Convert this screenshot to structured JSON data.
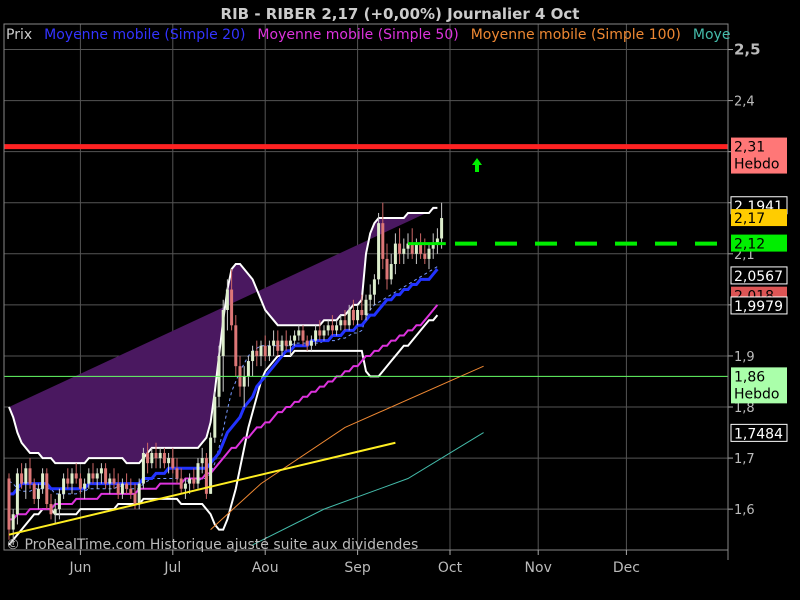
{
  "chart_data": {
    "type": "candlestick",
    "title": "RIB - RIBER     2,17 (+0,00%)     Journalier  4 Oct",
    "legend": [
      {
        "label": "Prix",
        "color": "#cccccc"
      },
      {
        "label": "Moyenne mobile (Simple 20)",
        "color": "#3333ff"
      },
      {
        "label": "Moyenne mobile (Simple 50)",
        "color": "#dd33dd"
      },
      {
        "label": "Moyenne mobile (Simple 100)",
        "color": "#ee8833"
      },
      {
        "label": "Moye",
        "color": "#44bbaa"
      }
    ],
    "x_tick_labels": [
      "Jun",
      "Jul",
      "Aou",
      "Sep",
      "Oct",
      "Nov",
      "Dec"
    ],
    "y_tick_labels": [
      "2,5",
      "2,4",
      "2,3",
      "2,2",
      "2,1",
      "2",
      "1,9",
      "1,8",
      "1,7",
      "1,6"
    ],
    "ylim": [
      1.52,
      2.55
    ],
    "grid": true,
    "watermark": "© ProRealTime.com Historique ajusté suite aux dividendes",
    "price_labels": [
      {
        "value": 2.31,
        "text": "2,31",
        "sub": "Hebdo",
        "bg": "#ff7777",
        "fg": "#000000"
      },
      {
        "value": 2.1941,
        "text": "2,1941",
        "bg": "#000000",
        "fg": "#ffffff",
        "border": "#ffffff"
      },
      {
        "value": 2.17,
        "text": "2,17",
        "bg": "#ffcc00",
        "fg": "#000000"
      },
      {
        "value": 2.12,
        "text": "2,12",
        "bg": "#00ee00",
        "fg": "#000000"
      },
      {
        "value": 2.056,
        "text": "2,056",
        "bg": "#cc33cc",
        "fg": "#000000"
      },
      {
        "value": 2.0567,
        "text": "2,0567",
        "bg": "#000000",
        "fg": "#ffffff",
        "border": "#ffffff"
      },
      {
        "value": 2.018,
        "text": "2,018",
        "bg": "#dd5555",
        "fg": "#000000"
      },
      {
        "value": 1.9979,
        "text": "1,9979",
        "bg": "#000000",
        "fg": "#ffffff",
        "border": "#ffffff"
      },
      {
        "value": 1.86,
        "text": "1,86",
        "sub": "Hebdo",
        "bg": "#aaffaa",
        "fg": "#000000"
      },
      {
        "value": 1.7484,
        "text": "1,7484",
        "bg": "#000000",
        "fg": "#ffffff",
        "border": "#ffffff"
      }
    ],
    "hlines": [
      {
        "value": 2.31,
        "color": "#ff2222"
      },
      {
        "value": 1.86,
        "color": "#66ff66"
      }
    ],
    "target_line": {
      "value": 2.12,
      "color": "#00ee00"
    },
    "trendline": [
      {
        "x": 0,
        "y": 1.55
      },
      {
        "x": 92,
        "y": 1.73
      }
    ],
    "up_arrow": {
      "x": 122,
      "y": 2.28,
      "color": "#00ee00"
    },
    "ma100_end": {
      "x": 113,
      "y": 1.88
    },
    "ma200_end": {
      "x": 113,
      "y": 1.75
    },
    "candles": [
      {
        "o": 1.66,
        "h": 1.67,
        "l": 1.54,
        "c": 1.56
      },
      {
        "o": 1.56,
        "h": 1.6,
        "l": 1.53,
        "c": 1.59
      },
      {
        "o": 1.59,
        "h": 1.68,
        "l": 1.57,
        "c": 1.67
      },
      {
        "o": 1.67,
        "h": 1.69,
        "l": 1.64,
        "c": 1.65
      },
      {
        "o": 1.65,
        "h": 1.69,
        "l": 1.62,
        "c": 1.68
      },
      {
        "o": 1.68,
        "h": 1.7,
        "l": 1.64,
        "c": 1.65
      },
      {
        "o": 1.65,
        "h": 1.66,
        "l": 1.61,
        "c": 1.62
      },
      {
        "o": 1.62,
        "h": 1.65,
        "l": 1.6,
        "c": 1.64
      },
      {
        "o": 1.64,
        "h": 1.68,
        "l": 1.63,
        "c": 1.67
      },
      {
        "o": 1.67,
        "h": 1.68,
        "l": 1.6,
        "c": 1.61
      },
      {
        "o": 1.61,
        "h": 1.63,
        "l": 1.58,
        "c": 1.59
      },
      {
        "o": 1.59,
        "h": 1.62,
        "l": 1.57,
        "c": 1.6
      },
      {
        "o": 1.6,
        "h": 1.64,
        "l": 1.58,
        "c": 1.63
      },
      {
        "o": 1.63,
        "h": 1.67,
        "l": 1.62,
        "c": 1.66
      },
      {
        "o": 1.66,
        "h": 1.68,
        "l": 1.64,
        "c": 1.65
      },
      {
        "o": 1.65,
        "h": 1.68,
        "l": 1.63,
        "c": 1.67
      },
      {
        "o": 1.67,
        "h": 1.69,
        "l": 1.65,
        "c": 1.66
      },
      {
        "o": 1.66,
        "h": 1.67,
        "l": 1.63,
        "c": 1.64
      },
      {
        "o": 1.64,
        "h": 1.66,
        "l": 1.62,
        "c": 1.65
      },
      {
        "o": 1.65,
        "h": 1.68,
        "l": 1.64,
        "c": 1.67
      },
      {
        "o": 1.67,
        "h": 1.69,
        "l": 1.65,
        "c": 1.66
      },
      {
        "o": 1.66,
        "h": 1.68,
        "l": 1.64,
        "c": 1.67
      },
      {
        "o": 1.67,
        "h": 1.69,
        "l": 1.65,
        "c": 1.68
      },
      {
        "o": 1.68,
        "h": 1.69,
        "l": 1.64,
        "c": 1.65
      },
      {
        "o": 1.65,
        "h": 1.67,
        "l": 1.63,
        "c": 1.66
      },
      {
        "o": 1.66,
        "h": 1.68,
        "l": 1.64,
        "c": 1.65
      },
      {
        "o": 1.65,
        "h": 1.67,
        "l": 1.62,
        "c": 1.63
      },
      {
        "o": 1.63,
        "h": 1.66,
        "l": 1.62,
        "c": 1.65
      },
      {
        "o": 1.65,
        "h": 1.67,
        "l": 1.63,
        "c": 1.64
      },
      {
        "o": 1.64,
        "h": 1.66,
        "l": 1.62,
        "c": 1.63
      },
      {
        "o": 1.63,
        "h": 1.65,
        "l": 1.6,
        "c": 1.61
      },
      {
        "o": 1.61,
        "h": 1.66,
        "l": 1.6,
        "c": 1.65
      },
      {
        "o": 1.65,
        "h": 1.72,
        "l": 1.64,
        "c": 1.71
      },
      {
        "o": 1.71,
        "h": 1.73,
        "l": 1.67,
        "c": 1.69
      },
      {
        "o": 1.69,
        "h": 1.72,
        "l": 1.68,
        "c": 1.71
      },
      {
        "o": 1.71,
        "h": 1.73,
        "l": 1.68,
        "c": 1.7
      },
      {
        "o": 1.7,
        "h": 1.72,
        "l": 1.68,
        "c": 1.71
      },
      {
        "o": 1.71,
        "h": 1.72,
        "l": 1.68,
        "c": 1.69
      },
      {
        "o": 1.69,
        "h": 1.71,
        "l": 1.67,
        "c": 1.7
      },
      {
        "o": 1.7,
        "h": 1.72,
        "l": 1.67,
        "c": 1.68
      },
      {
        "o": 1.68,
        "h": 1.7,
        "l": 1.65,
        "c": 1.66
      },
      {
        "o": 1.66,
        "h": 1.68,
        "l": 1.63,
        "c": 1.64
      },
      {
        "o": 1.64,
        "h": 1.66,
        "l": 1.62,
        "c": 1.65
      },
      {
        "o": 1.65,
        "h": 1.67,
        "l": 1.63,
        "c": 1.66
      },
      {
        "o": 1.66,
        "h": 1.68,
        "l": 1.64,
        "c": 1.65
      },
      {
        "o": 1.65,
        "h": 1.7,
        "l": 1.64,
        "c": 1.69
      },
      {
        "o": 1.69,
        "h": 1.72,
        "l": 1.67,
        "c": 1.7
      },
      {
        "o": 1.7,
        "h": 1.71,
        "l": 1.62,
        "c": 1.63
      },
      {
        "o": 1.63,
        "h": 1.75,
        "l": 1.63,
        "c": 1.74
      },
      {
        "o": 1.74,
        "h": 1.83,
        "l": 1.73,
        "c": 1.82
      },
      {
        "o": 1.82,
        "h": 1.92,
        "l": 1.8,
        "c": 1.9
      },
      {
        "o": 1.9,
        "h": 2.01,
        "l": 1.83,
        "c": 1.99
      },
      {
        "o": 1.99,
        "h": 2.05,
        "l": 1.95,
        "c": 2.03
      },
      {
        "o": 2.03,
        "h": 2.07,
        "l": 1.95,
        "c": 1.96
      },
      {
        "o": 1.96,
        "h": 1.98,
        "l": 1.86,
        "c": 1.88
      },
      {
        "o": 1.88,
        "h": 1.9,
        "l": 1.82,
        "c": 1.84
      },
      {
        "o": 1.84,
        "h": 1.88,
        "l": 1.8,
        "c": 1.86
      },
      {
        "o": 1.86,
        "h": 1.9,
        "l": 1.84,
        "c": 1.89
      },
      {
        "o": 1.89,
        "h": 1.92,
        "l": 1.86,
        "c": 1.91
      },
      {
        "o": 1.91,
        "h": 1.93,
        "l": 1.88,
        "c": 1.9
      },
      {
        "o": 1.9,
        "h": 1.93,
        "l": 1.88,
        "c": 1.92
      },
      {
        "o": 1.92,
        "h": 1.94,
        "l": 1.89,
        "c": 1.9
      },
      {
        "o": 1.9,
        "h": 1.93,
        "l": 1.89,
        "c": 1.92
      },
      {
        "o": 1.92,
        "h": 1.95,
        "l": 1.9,
        "c": 1.93
      },
      {
        "o": 1.93,
        "h": 1.95,
        "l": 1.9,
        "c": 1.91
      },
      {
        "o": 1.91,
        "h": 1.94,
        "l": 1.9,
        "c": 1.93
      },
      {
        "o": 1.93,
        "h": 1.95,
        "l": 1.91,
        "c": 1.92
      },
      {
        "o": 1.92,
        "h": 1.94,
        "l": 1.9,
        "c": 1.93
      },
      {
        "o": 1.93,
        "h": 1.95,
        "l": 1.92,
        "c": 1.94
      },
      {
        "o": 1.94,
        "h": 1.96,
        "l": 1.93,
        "c": 1.95
      },
      {
        "o": 1.95,
        "h": 1.96,
        "l": 1.92,
        "c": 1.93
      },
      {
        "o": 1.93,
        "h": 1.94,
        "l": 1.91,
        "c": 1.92
      },
      {
        "o": 1.92,
        "h": 1.94,
        "l": 1.91,
        "c": 1.93
      },
      {
        "o": 1.93,
        "h": 1.96,
        "l": 1.92,
        "c": 1.95
      },
      {
        "o": 1.95,
        "h": 1.97,
        "l": 1.93,
        "c": 1.94
      },
      {
        "o": 1.94,
        "h": 1.96,
        "l": 1.93,
        "c": 1.95
      },
      {
        "o": 1.95,
        "h": 1.97,
        "l": 1.94,
        "c": 1.96
      },
      {
        "o": 1.96,
        "h": 1.98,
        "l": 1.94,
        "c": 1.95
      },
      {
        "o": 1.95,
        "h": 1.97,
        "l": 1.94,
        "c": 1.96
      },
      {
        "o": 1.96,
        "h": 1.98,
        "l": 1.95,
        "c": 1.97
      },
      {
        "o": 1.97,
        "h": 1.99,
        "l": 1.95,
        "c": 1.96
      },
      {
        "o": 1.96,
        "h": 2.0,
        "l": 1.95,
        "c": 1.99
      },
      {
        "o": 1.99,
        "h": 2.01,
        "l": 1.96,
        "c": 1.97
      },
      {
        "o": 1.97,
        "h": 2.0,
        "l": 1.96,
        "c": 1.99
      },
      {
        "o": 1.99,
        "h": 2.02,
        "l": 1.97,
        "c": 1.98
      },
      {
        "o": 1.98,
        "h": 2.02,
        "l": 1.97,
        "c": 2.01
      },
      {
        "o": 2.01,
        "h": 2.04,
        "l": 1.99,
        "c": 2.02
      },
      {
        "o": 2.02,
        "h": 2.06,
        "l": 2.0,
        "c": 2.05
      },
      {
        "o": 2.05,
        "h": 2.18,
        "l": 2.04,
        "c": 2.16
      },
      {
        "o": 2.16,
        "h": 2.2,
        "l": 2.07,
        "c": 2.09
      },
      {
        "o": 2.09,
        "h": 2.12,
        "l": 2.03,
        "c": 2.05
      },
      {
        "o": 2.05,
        "h": 2.1,
        "l": 2.04,
        "c": 2.08
      },
      {
        "o": 2.08,
        "h": 2.14,
        "l": 2.06,
        "c": 2.12
      },
      {
        "o": 2.12,
        "h": 2.15,
        "l": 2.08,
        "c": 2.1
      },
      {
        "o": 2.1,
        "h": 2.13,
        "l": 2.08,
        "c": 2.11
      },
      {
        "o": 2.11,
        "h": 2.14,
        "l": 2.09,
        "c": 2.12
      },
      {
        "o": 2.12,
        "h": 2.15,
        "l": 2.09,
        "c": 2.1
      },
      {
        "o": 2.1,
        "h": 2.13,
        "l": 2.08,
        "c": 2.12
      },
      {
        "o": 2.12,
        "h": 2.14,
        "l": 2.09,
        "c": 2.1
      },
      {
        "o": 2.1,
        "h": 2.13,
        "l": 2.08,
        "c": 2.09
      },
      {
        "o": 2.09,
        "h": 2.12,
        "l": 2.07,
        "c": 2.11
      },
      {
        "o": 2.11,
        "h": 2.14,
        "l": 2.09,
        "c": 2.12
      },
      {
        "o": 2.12,
        "h": 2.15,
        "l": 2.1,
        "c": 2.13
      },
      {
        "o": 2.13,
        "h": 2.2,
        "l": 2.11,
        "c": 2.17
      }
    ],
    "ma20": [
      1.63,
      1.63,
      1.64,
      1.65,
      1.65,
      1.65,
      1.65,
      1.65,
      1.65,
      1.65,
      1.64,
      1.64,
      1.64,
      1.64,
      1.64,
      1.64,
      1.64,
      1.64,
      1.64,
      1.65,
      1.65,
      1.65,
      1.65,
      1.65,
      1.65,
      1.65,
      1.65,
      1.65,
      1.65,
      1.65,
      1.65,
      1.65,
      1.66,
      1.66,
      1.66,
      1.67,
      1.67,
      1.67,
      1.68,
      1.68,
      1.68,
      1.68,
      1.68,
      1.68,
      1.68,
      1.68,
      1.68,
      1.68,
      1.69,
      1.7,
      1.71,
      1.73,
      1.75,
      1.76,
      1.77,
      1.78,
      1.8,
      1.81,
      1.82,
      1.84,
      1.85,
      1.86,
      1.87,
      1.88,
      1.89,
      1.9,
      1.91,
      1.91,
      1.92,
      1.92,
      1.92,
      1.92,
      1.93,
      1.93,
      1.93,
      1.93,
      1.93,
      1.94,
      1.94,
      1.94,
      1.95,
      1.95,
      1.95,
      1.96,
      1.96,
      1.97,
      1.98,
      1.98,
      1.99,
      2.0,
      2.01,
      2.01,
      2.02,
      2.02,
      2.03,
      2.03,
      2.04,
      2.04,
      2.05,
      2.05,
      2.05,
      2.06,
      2.07
    ],
    "ma50": [
      1.58,
      1.58,
      1.59,
      1.59,
      1.59,
      1.6,
      1.6,
      1.6,
      1.6,
      1.6,
      1.6,
      1.61,
      1.61,
      1.61,
      1.61,
      1.61,
      1.62,
      1.62,
      1.62,
      1.62,
      1.62,
      1.62,
      1.63,
      1.63,
      1.63,
      1.63,
      1.63,
      1.63,
      1.63,
      1.63,
      1.63,
      1.64,
      1.64,
      1.64,
      1.64,
      1.64,
      1.65,
      1.65,
      1.65,
      1.65,
      1.65,
      1.65,
      1.66,
      1.66,
      1.66,
      1.66,
      1.66,
      1.67,
      1.67,
      1.68,
      1.69,
      1.7,
      1.71,
      1.72,
      1.72,
      1.73,
      1.74,
      1.74,
      1.75,
      1.76,
      1.76,
      1.77,
      1.77,
      1.78,
      1.79,
      1.79,
      1.8,
      1.8,
      1.81,
      1.81,
      1.82,
      1.82,
      1.83,
      1.83,
      1.84,
      1.84,
      1.85,
      1.85,
      1.86,
      1.86,
      1.87,
      1.87,
      1.88,
      1.88,
      1.89,
      1.9,
      1.9,
      1.91,
      1.91,
      1.92,
      1.92,
      1.93,
      1.93,
      1.94,
      1.94,
      1.95,
      1.95,
      1.96,
      1.96,
      1.97,
      1.98,
      1.99,
      2.0
    ],
    "bb_upper": [
      1.8,
      1.78,
      1.75,
      1.73,
      1.72,
      1.71,
      1.71,
      1.71,
      1.7,
      1.7,
      1.7,
      1.69,
      1.69,
      1.69,
      1.69,
      1.69,
      1.69,
      1.69,
      1.69,
      1.7,
      1.7,
      1.7,
      1.7,
      1.7,
      1.7,
      1.7,
      1.7,
      1.7,
      1.69,
      1.69,
      1.69,
      1.69,
      1.7,
      1.71,
      1.72,
      1.72,
      1.72,
      1.72,
      1.72,
      1.72,
      1.72,
      1.72,
      1.72,
      1.72,
      1.72,
      1.72,
      1.73,
      1.74,
      1.77,
      1.83,
      1.9,
      1.97,
      2.03,
      2.07,
      2.08,
      2.08,
      2.07,
      2.06,
      2.05,
      2.03,
      2.01,
      1.99,
      1.98,
      1.97,
      1.96,
      1.96,
      1.96,
      1.96,
      1.96,
      1.96,
      1.96,
      1.96,
      1.96,
      1.96,
      1.96,
      1.97,
      1.97,
      1.97,
      1.97,
      1.98,
      1.98,
      1.99,
      2.0,
      2.0,
      2.01,
      2.1,
      2.14,
      2.16,
      2.17,
      2.17,
      2.17,
      2.17,
      2.17,
      2.17,
      2.17,
      2.18,
      2.18,
      2.18,
      2.18,
      2.18,
      2.18,
      2.19,
      2.19
    ],
    "bb_lower": [
      1.53,
      1.54,
      1.55,
      1.56,
      1.57,
      1.58,
      1.59,
      1.59,
      1.6,
      1.6,
      1.6,
      1.59,
      1.59,
      1.59,
      1.59,
      1.59,
      1.59,
      1.6,
      1.6,
      1.6,
      1.6,
      1.6,
      1.6,
      1.6,
      1.6,
      1.6,
      1.61,
      1.61,
      1.61,
      1.61,
      1.61,
      1.61,
      1.62,
      1.62,
      1.62,
      1.62,
      1.62,
      1.62,
      1.62,
      1.62,
      1.62,
      1.61,
      1.61,
      1.61,
      1.61,
      1.61,
      1.61,
      1.6,
      1.59,
      1.57,
      1.56,
      1.56,
      1.58,
      1.61,
      1.64,
      1.68,
      1.72,
      1.76,
      1.79,
      1.82,
      1.85,
      1.87,
      1.88,
      1.89,
      1.9,
      1.9,
      1.9,
      1.9,
      1.91,
      1.91,
      1.91,
      1.91,
      1.91,
      1.91,
      1.91,
      1.91,
      1.91,
      1.91,
      1.91,
      1.91,
      1.91,
      1.91,
      1.91,
      1.91,
      1.91,
      1.87,
      1.86,
      1.86,
      1.86,
      1.87,
      1.88,
      1.89,
      1.9,
      1.91,
      1.92,
      1.92,
      1.93,
      1.94,
      1.95,
      1.96,
      1.97,
      1.97,
      1.98
    ]
  }
}
